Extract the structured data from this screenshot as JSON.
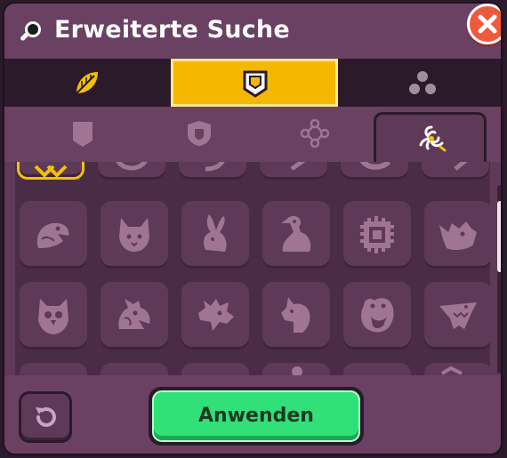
{
  "dialog": {
    "title": "Erweiterte Suche",
    "title_icon": "search-icon",
    "close_icon": "close-icon"
  },
  "main_tabs": [
    {
      "name": "tab-emblem-leaf",
      "icon": "leaf-icon",
      "active": false
    },
    {
      "name": "tab-emblem-shield",
      "icon": "shield-icon",
      "active": true
    },
    {
      "name": "tab-emblem-dots",
      "icon": "dots-icon",
      "active": false
    }
  ],
  "sub_tabs": [
    {
      "name": "subtab-banner",
      "icon": "banner-icon",
      "active": false
    },
    {
      "name": "subtab-badge",
      "icon": "badge-icon",
      "active": false
    },
    {
      "name": "subtab-nodes",
      "icon": "nodes-icon",
      "active": false
    },
    {
      "name": "subtab-symbols",
      "icon": "triskelion-icon",
      "active": true
    }
  ],
  "grid": {
    "rows": [
      [
        "top-partial",
        "top-partial",
        "top-partial",
        "top-partial",
        "top-partial",
        "top-partial"
      ],
      [
        "snake-icon",
        "cat-icon",
        "rabbit-icon",
        "goose-icon",
        "aztec-icon",
        "rhino-icon"
      ],
      [
        "owl-icon",
        "griffin-icon",
        "dragon-icon",
        "horse-icon",
        "hippo-icon",
        "shark-icon"
      ],
      [
        "bottom-partial",
        "bottom-partial",
        "bottom-partial",
        "bottom-partial",
        "bottom-partial",
        "bottom-partial"
      ]
    ]
  },
  "footer": {
    "reset_icon": "reset-icon",
    "apply_label": "Anwenden"
  },
  "colors": {
    "accent": "#f5b800",
    "apply": "#32e07a",
    "close": "#f05a3c",
    "panel": "#5e3a58",
    "icon": "#a07594"
  }
}
